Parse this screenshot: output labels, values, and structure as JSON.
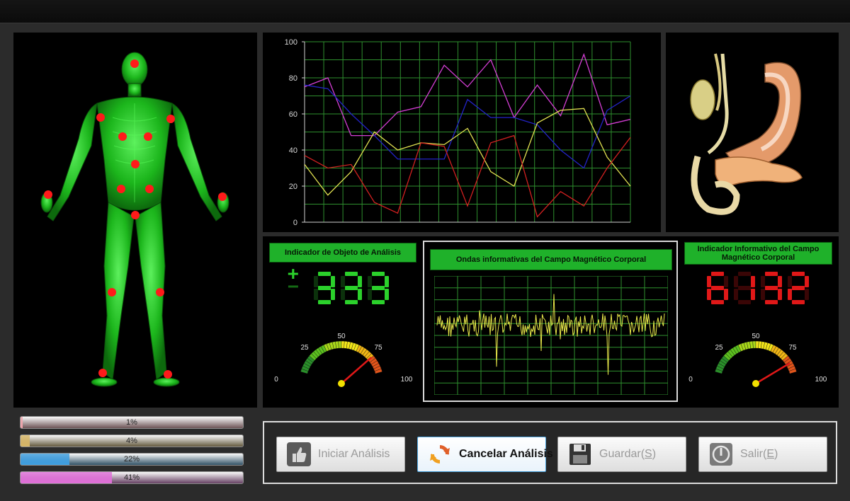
{
  "analysis_object": {
    "title": "Indicador de Objeto de Análisis",
    "sign_plus": "+",
    "sign_minus": "−",
    "digits": "333",
    "gauge_value": 83,
    "gauge_labels": [
      "0",
      "25",
      "50",
      "75",
      "100"
    ]
  },
  "waves": {
    "title": "Ondas informativas del Campo Magnético Corporal"
  },
  "field_indicator": {
    "title": "Indicador Informativo del Campo Magnético Corporal",
    "digits": "6132",
    "gauge_value": 90,
    "gauge_labels": [
      "0",
      "25",
      "50",
      "75",
      "100"
    ]
  },
  "progress": [
    {
      "label": "1%",
      "value": 1,
      "color": "#f2a6ae"
    },
    {
      "label": "4%",
      "value": 4,
      "color": "#d8b767"
    },
    {
      "label": "22%",
      "value": 22,
      "color": "#3f9fe0"
    },
    {
      "label": "41%",
      "value": 41,
      "color": "#e070d8"
    }
  ],
  "buttons": {
    "start": "Iniciar Análisis",
    "cancel": "Cancelar Análisis",
    "save_text": "Guardar(",
    "save_key": "S",
    "exit_text": "Salir(",
    "exit_key": "E",
    "close_paren": ")"
  },
  "colors": {
    "panel_bg": "#000000",
    "label_green": "#1fb12a",
    "digit_green": "#2bd12b",
    "digit_red": "#e01818",
    "body_green": "#1fc21f",
    "acupoint_red": "#ff1a1a"
  },
  "icons": [
    "thumbs-up-icon",
    "refresh-icon",
    "floppy-disk-icon",
    "power-icon"
  ],
  "chart_data": {
    "type": "line",
    "ylim": [
      0,
      100
    ],
    "yticks": [
      "0",
      "20",
      "40",
      "60",
      "80",
      "100"
    ],
    "x": [
      0,
      1,
      2,
      3,
      4,
      5,
      6,
      7,
      8,
      9,
      10,
      11,
      12,
      13,
      14,
      15,
      16,
      17
    ],
    "series": [
      {
        "color": "#d43ed4",
        "values": [
          75,
          80,
          48,
          48,
          61,
          64,
          87,
          75,
          90,
          58,
          76,
          59,
          93,
          54,
          57
        ]
      },
      {
        "color": "#2323c8",
        "values": [
          76,
          74,
          60,
          48,
          35,
          35,
          35,
          68,
          58,
          58,
          54,
          40,
          30,
          62,
          70
        ]
      },
      {
        "color": "#e0e050",
        "values": [
          32,
          15,
          28,
          50,
          40,
          44,
          43,
          52,
          28,
          20,
          55,
          62,
          63,
          36,
          20
        ]
      },
      {
        "color": "#d22020",
        "values": [
          37,
          30,
          32,
          11,
          5,
          44,
          42,
          9,
          44,
          48,
          3,
          17,
          9,
          30,
          47
        ]
      }
    ]
  }
}
